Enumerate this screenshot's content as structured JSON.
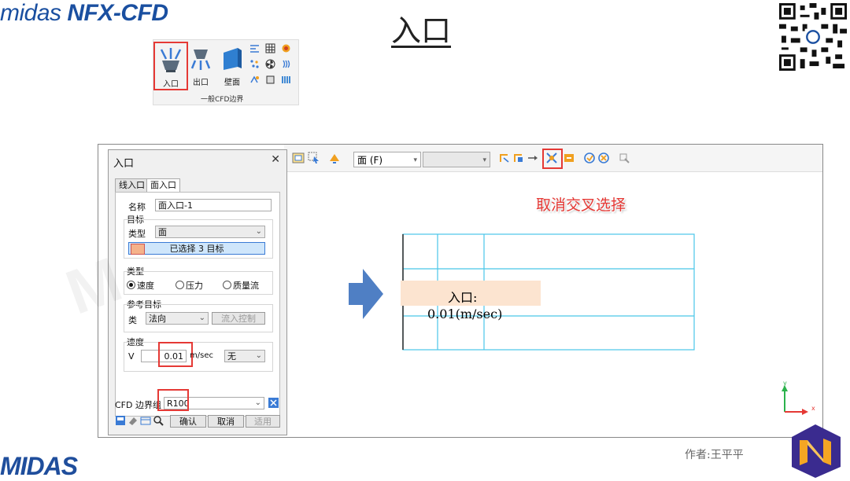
{
  "brand": {
    "text_light": "midas ",
    "text_bold": "NFX-CFD"
  },
  "slide_title": "入口",
  "ribbon": {
    "inlet_label": "入口",
    "outlet_label": "出口",
    "wall_label": "壁面",
    "group_label": "一般CFD边界"
  },
  "toolbar": {
    "face_select": "面 (F)",
    "second_select": ""
  },
  "dialog": {
    "title": "入口",
    "close_icon": "close-icon",
    "tabs": [
      "线入口",
      "面入口"
    ],
    "name_label": "名称",
    "name_value": "面入口-1",
    "target_group": "目标",
    "type_label": "类型",
    "type_value": "面",
    "selected_button": "已选择 3 目标",
    "kind_group": "类型",
    "radio_velocity": "速度",
    "radio_pressure": "压力",
    "radio_mass": "质量流",
    "ref_group": "参考目标",
    "ref_type_label": "类",
    "ref_type_value": "法向",
    "flow_control": "流入控制",
    "speed_group": "速度",
    "v_label": "V",
    "v_value": "0.01",
    "v_unit": "m/sec",
    "v_func": "无",
    "bc_group_label": "CFD 边界组",
    "bc_group_value": "R100",
    "ok": "确认",
    "cancel": "取消",
    "apply": "适用"
  },
  "canvas": {
    "note": "取消交叉选择",
    "label_line1": "入口:",
    "label_line2": "0.01(m/sec)",
    "axis_y": "y",
    "axis_x": "x"
  },
  "author": "作者:王平平",
  "bottom_logo": "MIDAS",
  "colors": {
    "accent_red": "#e53935",
    "brand_blue": "#1a4fa0",
    "grid_cyan": "#49c6e8",
    "label_bg": "#fce4d0"
  }
}
